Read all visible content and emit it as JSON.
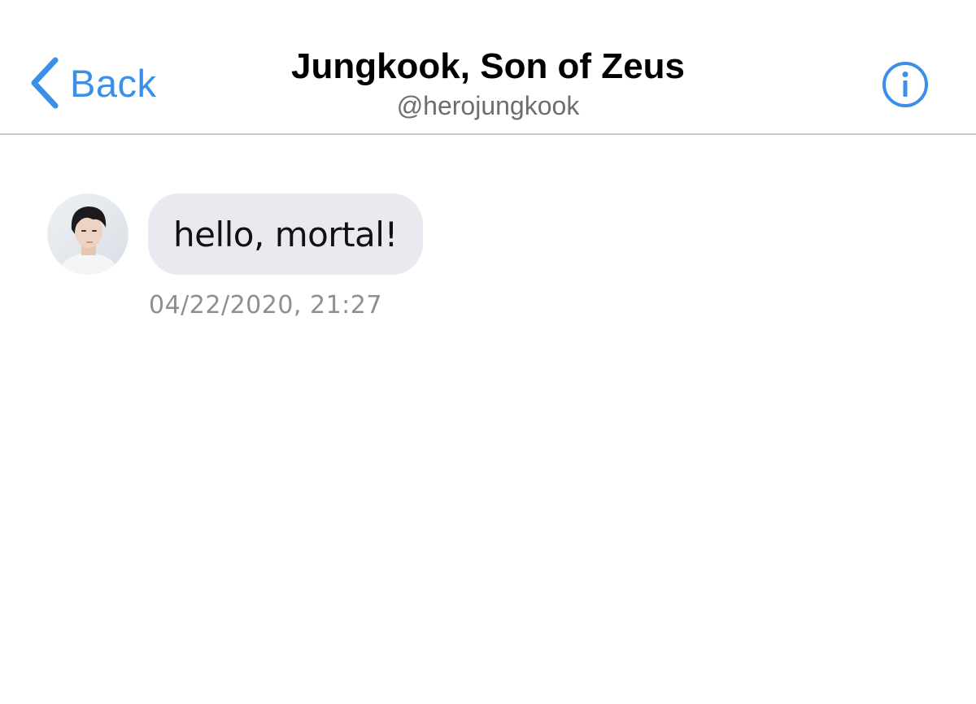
{
  "header": {
    "back_label": "Back",
    "back_icon": "chevron-left-icon",
    "title": "Jungkook, Son of Zeus",
    "subtitle": "@herojungkook",
    "info_icon": "info-icon",
    "accent_color": "#3a8fe8"
  },
  "conversation": {
    "messages": [
      {
        "text": "hello, mortal!",
        "timestamp": "04/22/2020, 21:27",
        "avatar": "profile-photo"
      }
    ]
  }
}
